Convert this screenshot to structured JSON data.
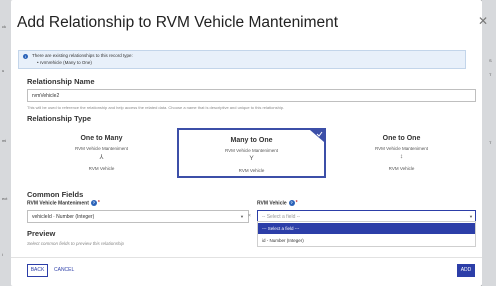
{
  "background": {
    "left_snippets": [
      "ck",
      "u",
      "mi",
      "ect",
      "i"
    ],
    "right_snippets": [
      "S",
      "T",
      "T"
    ]
  },
  "modal": {
    "title": "Add Relationship to RVM Vehicle Manteniment",
    "close_icon": "close-icon"
  },
  "info": {
    "text": "There are existing relationships to this record type:",
    "bullet": "• rvmVehicle (Many to One)"
  },
  "relationship_name": {
    "heading": "Relationship Name",
    "value": "rvmVehicle2",
    "help": "This will be used to reference the relationship and help access the related data. Choose a name that is descriptive and unique to this relationship."
  },
  "relationship_type": {
    "heading": "Relationship Type",
    "cards": [
      {
        "title": "One to Many",
        "from": "RVM Vehicle Manteniment",
        "icon": "⅄",
        "to": "RVM Vehicle"
      },
      {
        "title": "Many to One",
        "from": "RVM Vehicle Manteniment",
        "icon": "Y",
        "to": "RVM Vehicle"
      },
      {
        "title": "One to One",
        "from": "RVM Vehicle Manteniment",
        "icon": "↕",
        "to": "RVM Vehicle"
      }
    ],
    "selected_index": 1
  },
  "common_fields": {
    "heading": "Common Fields",
    "left_label": "RVM Vehicle Manteniment",
    "left_value": "vehicleId · Number (Integer)",
    "right_label": "RVM Vehicle",
    "right_placeholder": "-- Select a field --",
    "options": [
      "--- Select a field ---",
      "id - Number (Integer)"
    ]
  },
  "preview": {
    "heading": "Preview",
    "placeholder": "Select common fields to preview this relationship"
  },
  "footer": {
    "back": "BACK",
    "cancel": "CANCEL",
    "add": "ADD"
  },
  "colors": {
    "primary": "#2c3ea8",
    "info_bg": "#e8f0fa",
    "required": "#c23030"
  }
}
